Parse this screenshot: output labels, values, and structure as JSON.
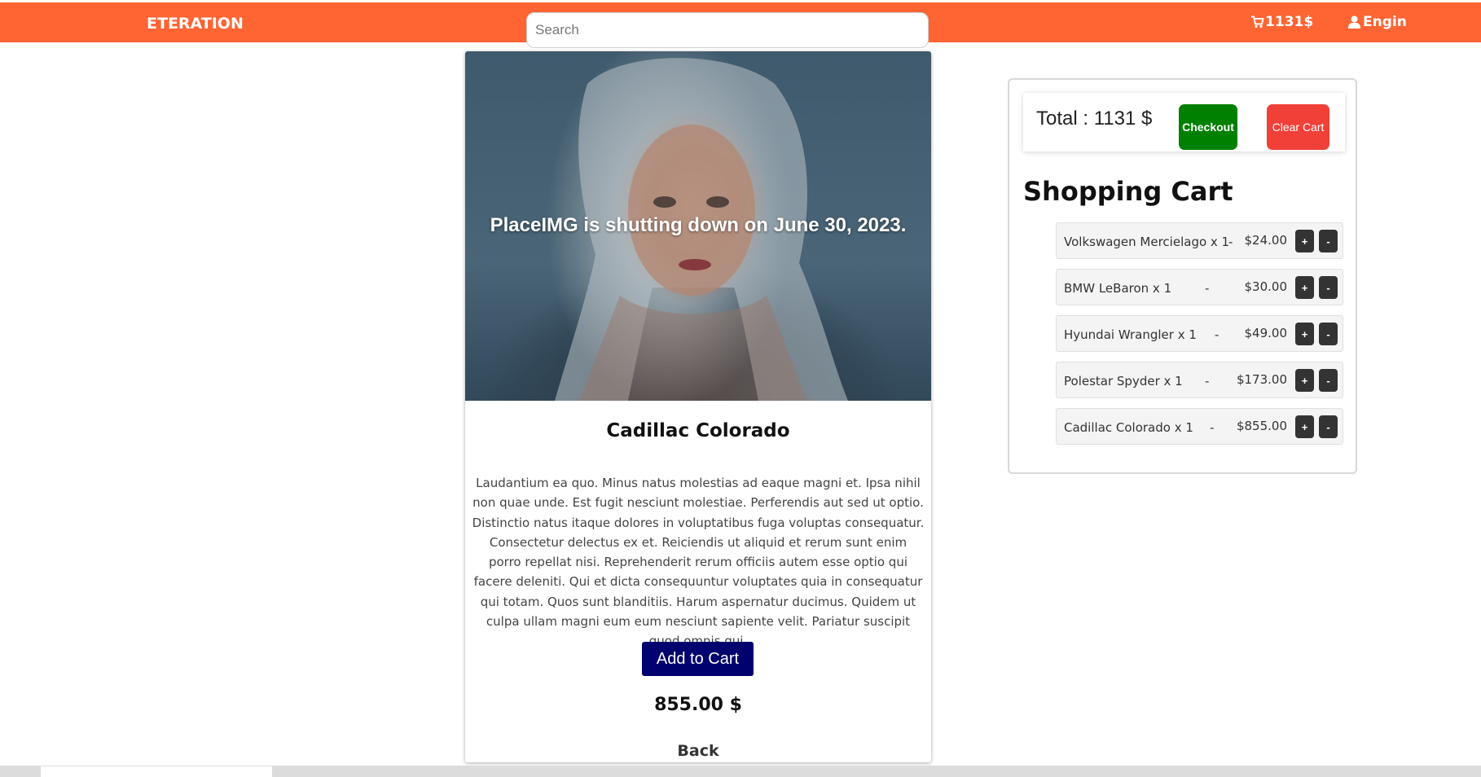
{
  "navbar": {
    "brand": "ETERATION",
    "search_placeholder": "Search",
    "cart_total": "1131$",
    "cart_icon": "cart-icon",
    "user_name": "Engin",
    "user_icon": "user-icon",
    "accent_color": "#ff6433"
  },
  "product": {
    "image_overlay_text": "PlaceIMG is shutting down on June 30, 2023.",
    "title": "Cadillac Colorado",
    "description": "Laudantium ea quo. Minus natus molestias ad eaque magni et. Ipsa nihil non quae unde. Est fugit nesciunt molestiae. Perferendis aut sed ut optio. Distinctio natus itaque dolores in voluptatibus fuga voluptas consequatur. Consectetur delectus ex et. Reiciendis ut aliquid et rerum sunt enim porro repellat nisi. Reprehenderit rerum officiis autem esse optio qui facere deleniti. Qui et dicta consequuntur voluptates quia in consequatur qui totam. Quos sunt blanditiis. Harum aspernatur ducimus. Quidem ut culpa ullam magni eum eum nesciunt sapiente velit. Pariatur suscipit quod omnis qui.",
    "add_to_cart_label": "Add to Cart",
    "price": "855.00 $",
    "back_label": "Back"
  },
  "cart": {
    "total_text": "Total : 1131 $",
    "checkout_label": "Checkout",
    "clear_label": "Clear Cart",
    "heading": "Shopping Cart",
    "items": [
      {
        "name": "Volkswagen Mercielago x 1",
        "separator": "-",
        "price": "$24.00",
        "plus": "+",
        "minus": "-"
      },
      {
        "name": "BMW LeBaron x 1",
        "separator": "-",
        "price": "$30.00",
        "plus": "+",
        "minus": "-"
      },
      {
        "name": "Hyundai Wrangler x 1",
        "separator": "-",
        "price": "$49.00",
        "plus": "+",
        "minus": "-"
      },
      {
        "name": "Polestar Spyder x 1",
        "separator": "-",
        "price": "$173.00",
        "plus": "+",
        "minus": "-"
      },
      {
        "name": "Cadillac Colorado x 1",
        "separator": "-",
        "price": "$855.00",
        "plus": "+",
        "minus": "-"
      }
    ]
  }
}
